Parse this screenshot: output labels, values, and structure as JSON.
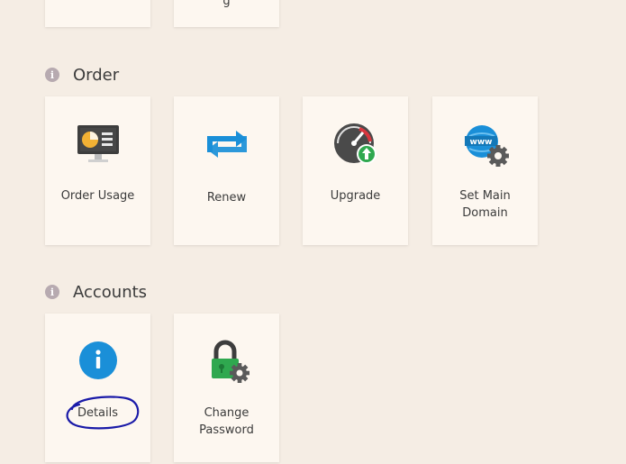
{
  "top_row": {
    "tiles": [
      {
        "label": ""
      },
      {
        "label": "g"
      }
    ]
  },
  "order": {
    "title": "Order",
    "tiles": [
      {
        "label": "Order Usage",
        "icon": "monitor-chart-icon"
      },
      {
        "label": "Renew",
        "icon": "renew-arrows-icon"
      },
      {
        "label": "Upgrade",
        "icon": "speedometer-upgrade-icon"
      },
      {
        "label": "Set Main\nDomain",
        "icon": "www-globe-gear-icon"
      }
    ]
  },
  "accounts": {
    "title": "Accounts",
    "tiles": [
      {
        "label": "Details",
        "icon": "info-circle-icon"
      },
      {
        "label": "Change\nPassword",
        "icon": "lock-gear-icon"
      }
    ]
  },
  "colors": {
    "background": "#f5ede4",
    "tile": "#fdf7f0",
    "blue": "#1a8fd8",
    "green": "#2fa84f",
    "annotation": "#1a1aa8"
  }
}
